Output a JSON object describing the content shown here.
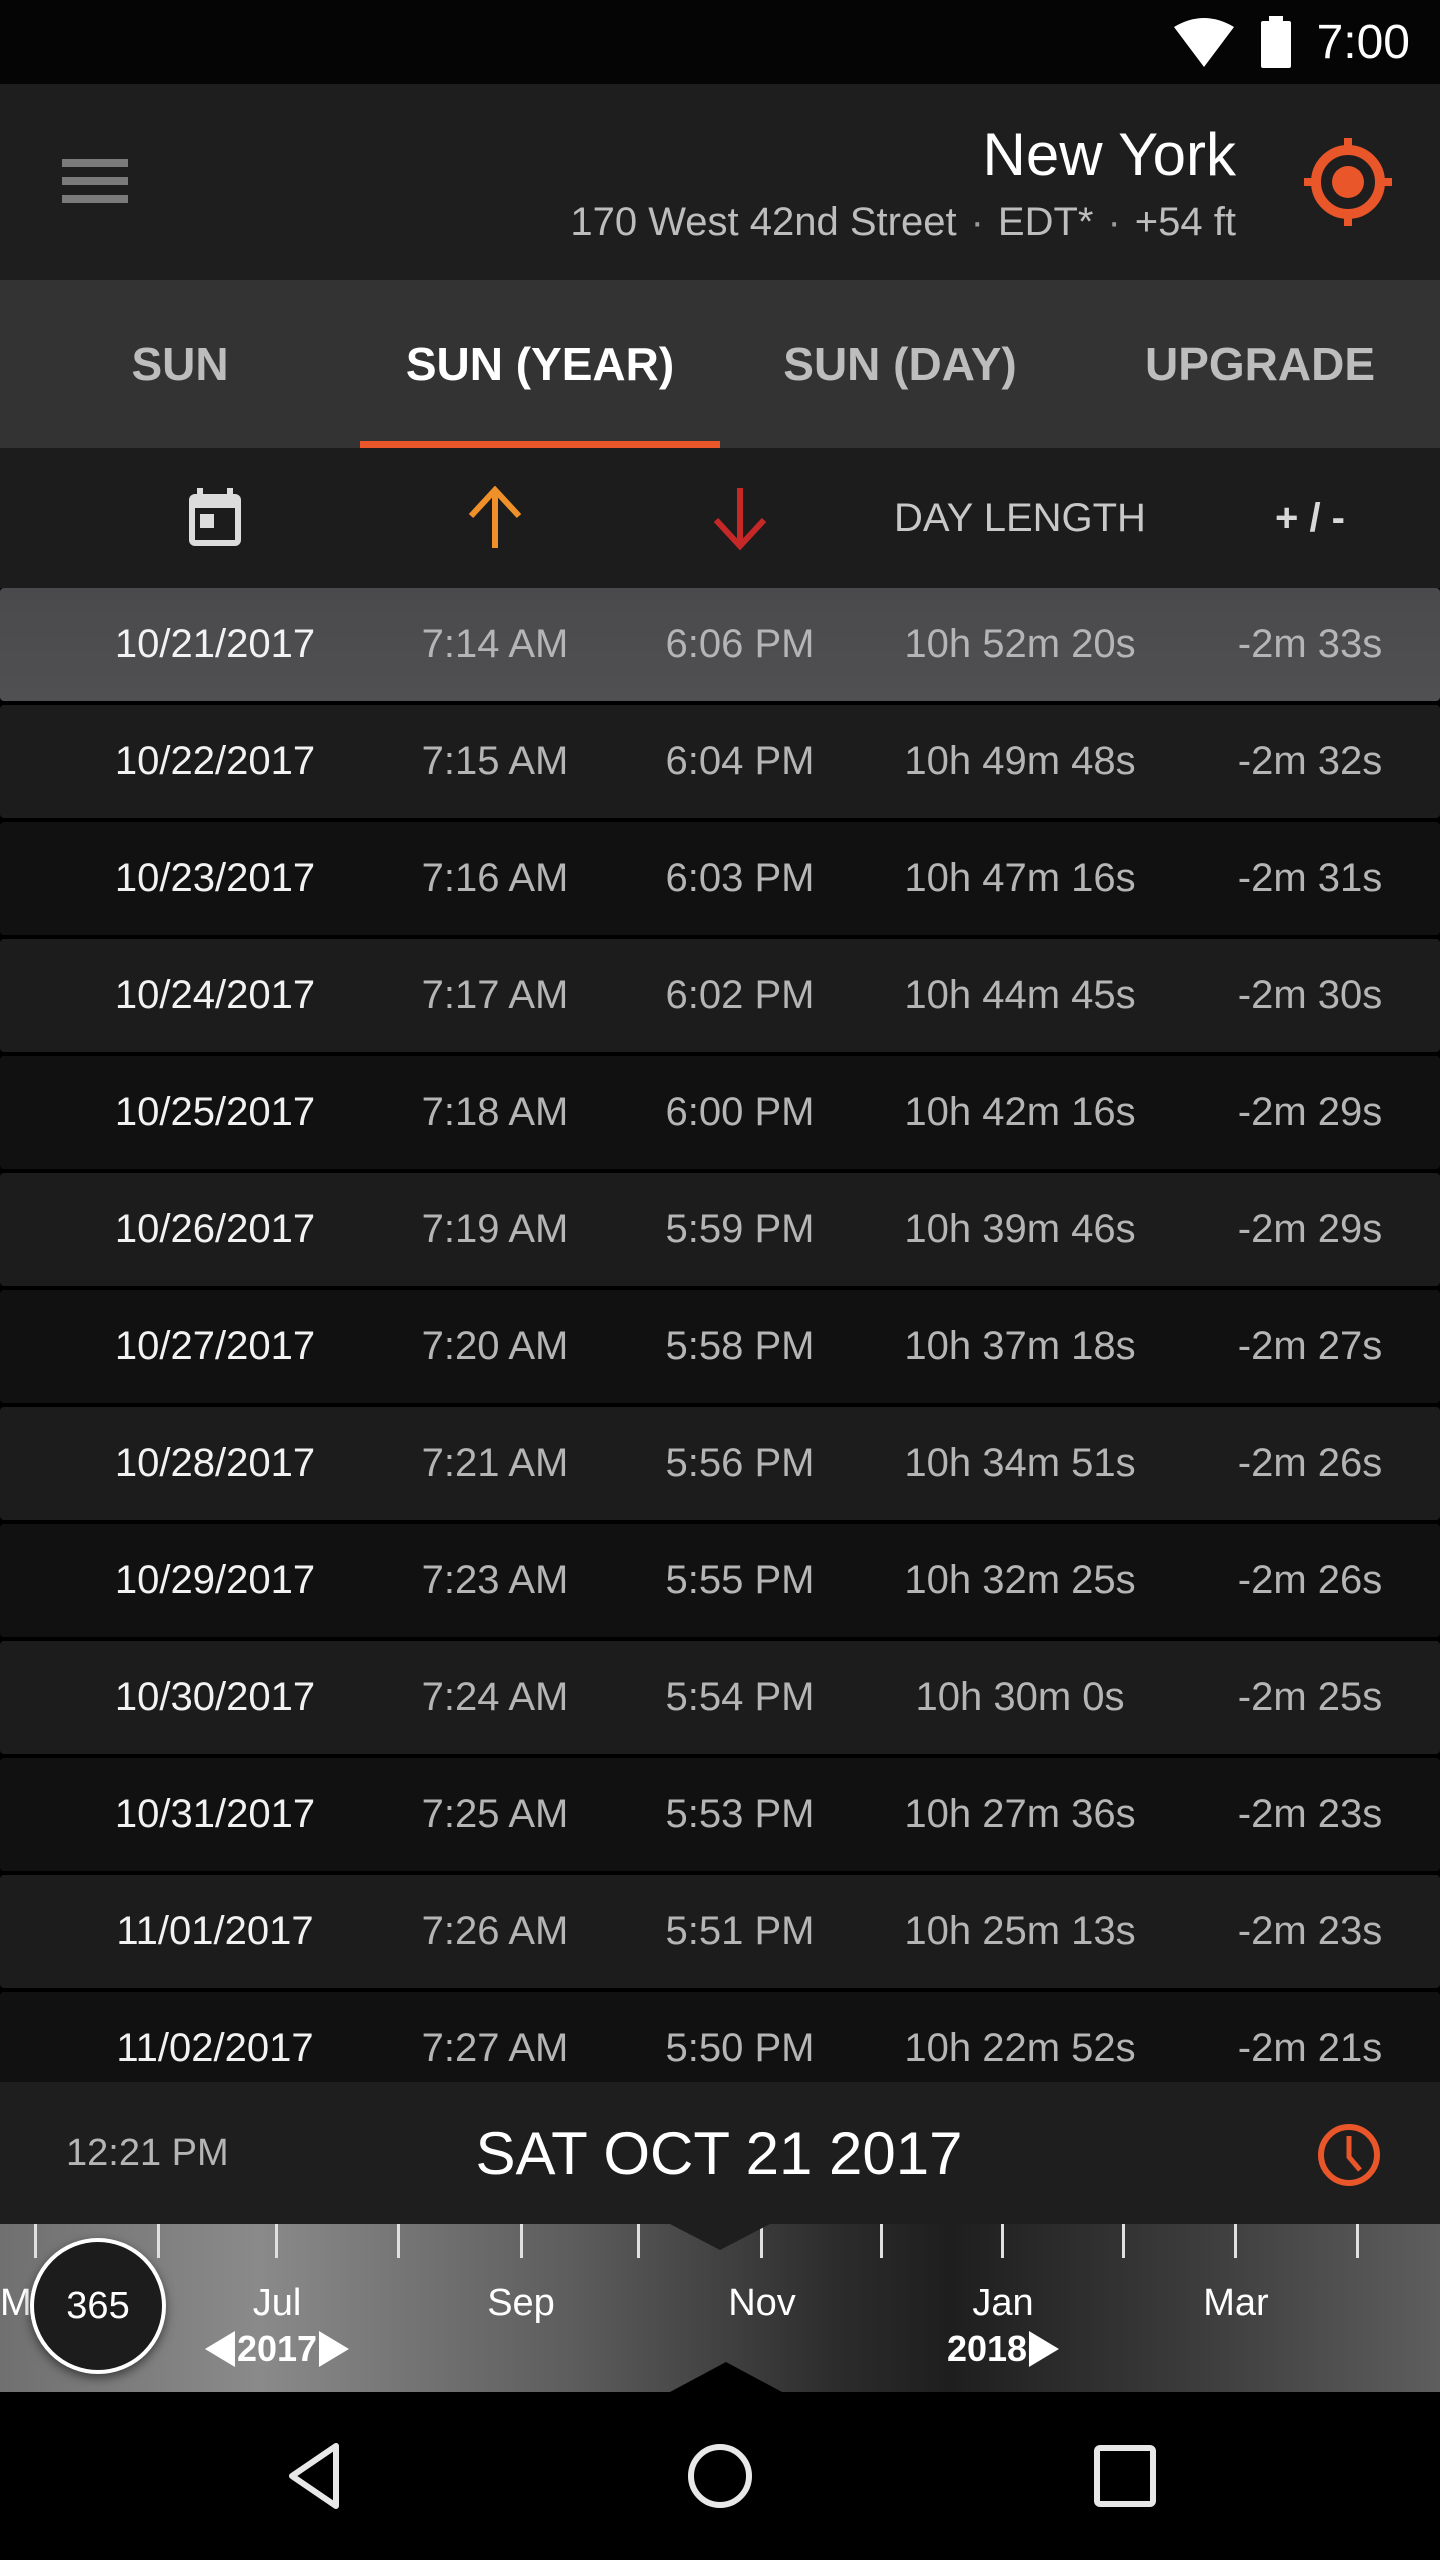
{
  "status_bar": {
    "time": "7:00",
    "icons": [
      "wifi-icon",
      "battery-icon"
    ]
  },
  "header": {
    "menu_icon": "hamburger-menu-icon",
    "location_name": "New York",
    "address": "170 West 42nd Street",
    "timezone": "EDT*",
    "elevation": "+54 ft",
    "separator": "·",
    "gps_icon": "gps-target-icon",
    "accent_color": "#e8562a"
  },
  "tabs": [
    {
      "label": "SUN",
      "active": false
    },
    {
      "label": "SUN (YEAR)",
      "active": true
    },
    {
      "label": "SUN (DAY)",
      "active": false
    },
    {
      "label": "UPGRADE",
      "active": false
    }
  ],
  "columns": {
    "date_icon": "calendar-icon",
    "sunrise_icon": "arrow-up-icon",
    "sunset_icon": "arrow-down-icon",
    "day_length": "DAY LENGTH",
    "diff": "+ / -",
    "sunrise_color": "#f0902a",
    "sunset_color": "#c62828"
  },
  "rows": [
    {
      "date": "10/21/2017",
      "sunrise": "7:14 AM",
      "sunset": "6:06 PM",
      "length": "10h 52m 20s",
      "diff": "-2m 33s",
      "selected": true
    },
    {
      "date": "10/22/2017",
      "sunrise": "7:15 AM",
      "sunset": "6:04 PM",
      "length": "10h 49m 48s",
      "diff": "-2m 32s"
    },
    {
      "date": "10/23/2017",
      "sunrise": "7:16 AM",
      "sunset": "6:03 PM",
      "length": "10h 47m 16s",
      "diff": "-2m 31s"
    },
    {
      "date": "10/24/2017",
      "sunrise": "7:17 AM",
      "sunset": "6:02 PM",
      "length": "10h 44m 45s",
      "diff": "-2m 30s"
    },
    {
      "date": "10/25/2017",
      "sunrise": "7:18 AM",
      "sunset": "6:00 PM",
      "length": "10h 42m 16s",
      "diff": "-2m 29s"
    },
    {
      "date": "10/26/2017",
      "sunrise": "7:19 AM",
      "sunset": "5:59 PM",
      "length": "10h 39m 46s",
      "diff": "-2m 29s"
    },
    {
      "date": "10/27/2017",
      "sunrise": "7:20 AM",
      "sunset": "5:58 PM",
      "length": "10h 37m 18s",
      "diff": "-2m 27s"
    },
    {
      "date": "10/28/2017",
      "sunrise": "7:21 AM",
      "sunset": "5:56 PM",
      "length": "10h 34m 51s",
      "diff": "-2m 26s"
    },
    {
      "date": "10/29/2017",
      "sunrise": "7:23 AM",
      "sunset": "5:55 PM",
      "length": "10h 32m 25s",
      "diff": "-2m 26s"
    },
    {
      "date": "10/30/2017",
      "sunrise": "7:24 AM",
      "sunset": "5:54 PM",
      "length": "10h 30m 0s",
      "diff": "-2m 25s"
    },
    {
      "date": "10/31/2017",
      "sunrise": "7:25 AM",
      "sunset": "5:53 PM",
      "length": "10h 27m 36s",
      "diff": "-2m 23s"
    },
    {
      "date": "11/01/2017",
      "sunrise": "7:26 AM",
      "sunset": "5:51 PM",
      "length": "10h 25m 13s",
      "diff": "-2m 23s"
    },
    {
      "date": "11/02/2017",
      "sunrise": "7:27 AM",
      "sunset": "5:50 PM",
      "length": "10h 22m 52s",
      "diff": "-2m 21s"
    }
  ],
  "date_bar": {
    "time": "12:21 PM",
    "date": "SAT OCT 21 2017",
    "clock_icon": "clock-icon"
  },
  "timeline": {
    "days_badge": "365",
    "clipped_month": "M",
    "months": [
      {
        "label": "Jul",
        "year": "2017",
        "year_arrows": "both"
      },
      {
        "label": "Sep"
      },
      {
        "label": "Nov"
      },
      {
        "label": "Jan",
        "year": "2018",
        "year_arrows": "right"
      },
      {
        "label": "Mar"
      }
    ]
  },
  "nav_bar": {
    "icons": [
      "back-icon",
      "home-icon",
      "recents-icon"
    ]
  }
}
